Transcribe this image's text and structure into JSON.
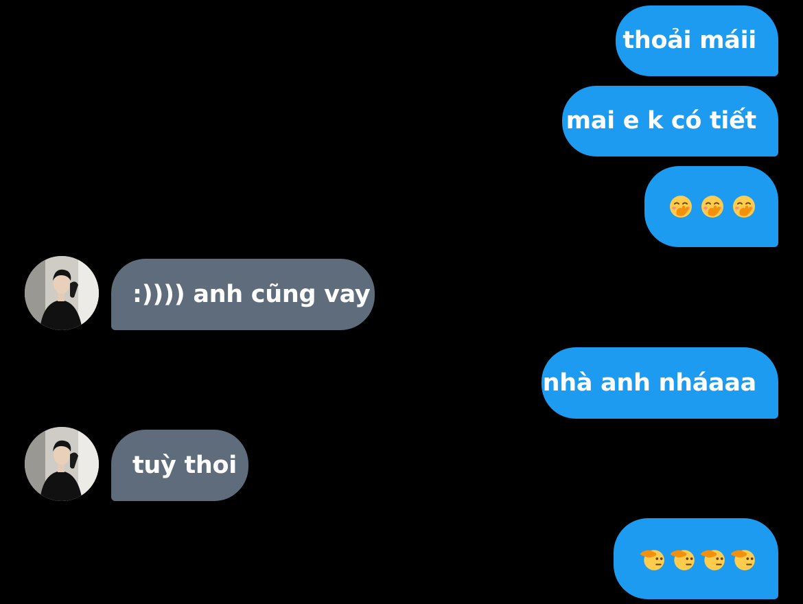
{
  "colors": {
    "background": "#000000",
    "outgoing_bubble": "#1d9bf0",
    "incoming_bubble": "#5f6c7b",
    "text": "#ffffff"
  },
  "messages": [
    {
      "direction": "outgoing",
      "text": "thoải máii"
    },
    {
      "direction": "outgoing",
      "text": "mai e k có tiết"
    },
    {
      "direction": "outgoing",
      "emoji": [
        "face-with-hand-over-mouth",
        "face-with-hand-over-mouth",
        "face-with-hand-over-mouth"
      ]
    },
    {
      "direction": "incoming",
      "text": ":)))) anh cũng vay",
      "avatar": "contact-avatar"
    },
    {
      "direction": "outgoing",
      "text": "nhà anh nháaaa"
    },
    {
      "direction": "incoming",
      "text": "tuỳ thoi",
      "avatar": "contact-avatar"
    },
    {
      "direction": "outgoing",
      "emoji": [
        "saluting-face",
        "saluting-face",
        "saluting-face",
        "saluting-face"
      ]
    }
  ]
}
